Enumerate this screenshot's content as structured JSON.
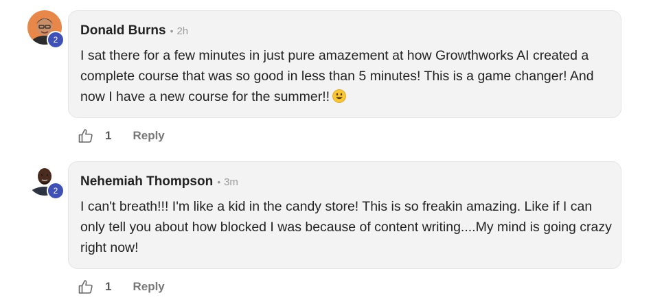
{
  "comments": [
    {
      "author": "Donald Burns",
      "separator": "•",
      "time": "2h",
      "level": "2",
      "text": "I sat there for a few minutes in just pure amazement at how Growthworks AI created a complete course that was so good in less than 5 minutes! This is a game changer! And now I have a new course for the summer!!",
      "emoji_icon": "smiley-emoji-icon",
      "likes": "1",
      "reply_label": "Reply"
    },
    {
      "author": "Nehemiah Thompson",
      "separator": "•",
      "time": "3m",
      "level": "2",
      "text": "I can't breath!!! I'm like a kid in the candy store! This is so freakin amazing. Like if I can only tell you about how blocked I was because of content writing....My mind is going crazy right now!",
      "likes": "1",
      "reply_label": "Reply"
    }
  ],
  "colors": {
    "level_badge": "#3f51b5",
    "bubble_background": "#f3f3f3",
    "muted_text": "#9a9a9a"
  }
}
